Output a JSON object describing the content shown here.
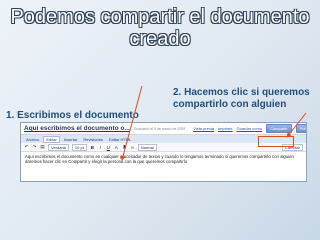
{
  "slide": {
    "title_line1": "Podemos compartir el documento",
    "title_line2": "creado",
    "callout_share": "2. Hacemos clic si queremos compartirlo con alguien",
    "callout_write": "1. Escribimos el documento"
  },
  "screenshot": {
    "doc_title": "Aquí escribimos el documento o...",
    "autosave_note": "Guardado el 9 de marzo de 2009",
    "header_links": [
      "Vista previa",
      "Imprimir",
      "Guardar como",
      "Compartir"
    ],
    "buttons": {
      "share": "Compartir",
      "publish": "Publicar"
    },
    "menus": [
      "Archivo",
      "Editar",
      "Insertar",
      "Revisiones",
      "Editar HTML"
    ],
    "active_menu": "Editar",
    "toolbar": {
      "font": "Verdana",
      "size": "10 pt",
      "style": "Normal",
      "change": "Cambiar"
    },
    "toolbar_icons": [
      "undo-icon",
      "redo-icon",
      "print-icon",
      "bold-icon",
      "italic-icon",
      "underline-icon",
      "text-color-icon",
      "highlight-icon",
      "link-icon"
    ],
    "body": "Aquí escribimos el documento como en cualquier procesador de textos y cuando lo tengamos terminado si queremos compartirlo con alguien daremos hacer clic en Compartir y elegir la persona con la que queremos compartirlo"
  },
  "colors": {
    "title_outline": "#2b3f57",
    "callout": "#1f4e79",
    "arrow": "#e04a1f",
    "share_button": "#6f8fcd"
  }
}
